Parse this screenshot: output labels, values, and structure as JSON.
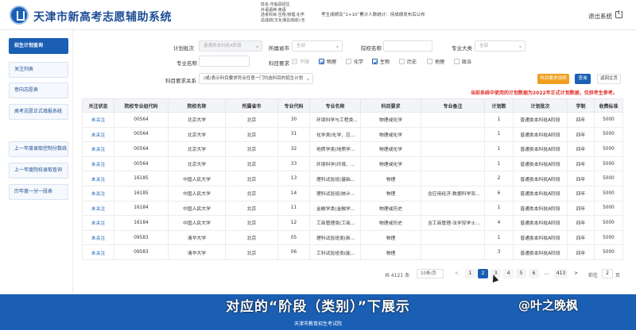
{
  "header": {
    "title": "天津市新高考志愿辅助系统",
    "user_lines": [
      "姓名:市临县招生",
      "外语语种:英语",
      "选考科目:生物,物理,化学",
      "总成绩(文化课总成绩):无"
    ],
    "notice": "考生成绩及“1+10”累计人数统计：待成绩发布后公布",
    "exit_label": "退出系统"
  },
  "sidebar": {
    "items": [
      {
        "label": "招生计划查询",
        "active": true
      },
      {
        "label": "关注列表",
        "active": false
      },
      {
        "label": "意向志愿表",
        "active": false
      },
      {
        "label": "高考志愿正式填报系统",
        "active": false
      },
      {
        "label": "上一年度录取控制分数线",
        "active": false
      },
      {
        "label": "上一年度院校录取查询",
        "active": false
      },
      {
        "label": "历年度一分一段表",
        "active": false
      }
    ]
  },
  "filters": {
    "plan_batch": {
      "label": "计划批次",
      "value": "普通类本科批A阶段"
    },
    "province": {
      "label": "所属省市",
      "placeholder": "全部"
    },
    "school_name": {
      "label": "院校名称",
      "value": ""
    },
    "major_category": {
      "label": "专业大类",
      "placeholder": "全部"
    },
    "major_name": {
      "label": "专业名称",
      "value": ""
    },
    "subject_req": {
      "label": "科目要求",
      "options": [
        {
          "label": "不限",
          "checked": false,
          "disabled": true
        },
        {
          "label": "物理",
          "checked": true,
          "disabled": false
        },
        {
          "label": "化学",
          "checked": false,
          "disabled": false
        },
        {
          "label": "生物",
          "checked": true,
          "disabled": false
        },
        {
          "label": "历史",
          "checked": false,
          "disabled": false
        },
        {
          "label": "地理",
          "checked": false,
          "disabled": false
        },
        {
          "label": "政治",
          "checked": false,
          "disabled": false
        }
      ]
    },
    "subject_relation": {
      "label": "科目要求关系",
      "value": "(或)表示科目要求符合任意一门均选科目的招生计划"
    }
  },
  "buttons": {
    "subject_explain": "科目要求说明",
    "search": "查询",
    "back_home": "返回主页"
  },
  "warning": "当前系统中使用的计划数据为2022年正式计划数据，仅供考生参考。",
  "table": {
    "headers": [
      "关注状态",
      "院校专业组代码",
      "院校名称",
      "所属省市",
      "专业代码",
      "专业名称",
      "科目要求",
      "专业备注",
      "计划数",
      "计划批次",
      "学制",
      "收费标准"
    ],
    "rows": [
      [
        "未关注",
        "00564",
        "北京大学",
        "北京",
        "30",
        "环境科学与工程类...",
        "物理或化学",
        "",
        "1",
        "普通类本科批A阶段",
        "四年",
        "5000"
      ],
      [
        "未关注",
        "00564",
        "北京大学",
        "北京",
        "31",
        "化学类(化学、应...",
        "物理或化学",
        "",
        "1",
        "普通类本科批A阶段",
        "四年",
        "5000"
      ],
      [
        "未关注",
        "00564",
        "北京大学",
        "北京",
        "32",
        "地质学类(地质学...",
        "物理或化学",
        "",
        "1",
        "普通类本科批A阶段",
        "四年",
        "5000"
      ],
      [
        "未关注",
        "00564",
        "北京大学",
        "北京",
        "33",
        "环境科学(环境、...",
        "物理或化学",
        "",
        "1",
        "普通类本科批A阶段",
        "四年",
        "5000"
      ],
      [
        "未关注",
        "16185",
        "中国人民大学",
        "北京",
        "13",
        "理科试验班(基础...",
        "物理",
        "",
        "2",
        "普通类本科批A阶段",
        "四年",
        "5000"
      ],
      [
        "未关注",
        "16185",
        "中国人民大学",
        "北京",
        "14",
        "理科试验班(统计...",
        "物理",
        "含应用经济-数据科学双...",
        "6",
        "普通类本科批A阶段",
        "四年",
        "5000"
      ],
      [
        "未关注",
        "16184",
        "中国人民大学",
        "北京",
        "11",
        "金融学类(金融学...",
        "物理或历史",
        "",
        "1",
        "普通类本科批A阶段",
        "四年",
        "5000"
      ],
      [
        "未关注",
        "16184",
        "中国人民大学",
        "北京",
        "12",
        "工商管理类(工商...",
        "物理或历史",
        "含工商管理-法学双学士...",
        "4",
        "普通类本科批A阶段",
        "四年",
        "5000"
      ],
      [
        "未关注",
        "09583",
        "清华大学",
        "北京",
        "05",
        "理科试验班类(新...",
        "物理",
        "",
        "1",
        "普通类本科批A阶段",
        "四年",
        "5000"
      ],
      [
        "未关注",
        "09583",
        "清华大学",
        "北京",
        "06",
        "工科试验班类(能...",
        "物理",
        "",
        "3",
        "普通类本科批A阶段",
        "四年",
        "5000"
      ]
    ]
  },
  "pagination": {
    "total": "共 4121 条",
    "page_size": "10条/页",
    "prev": "<",
    "pages": [
      "1",
      "2",
      "3",
      "4",
      "5",
      "6",
      "...",
      "413"
    ],
    "current": "2",
    "next": ">",
    "goto_label": "前往",
    "goto_value": "2",
    "goto_suffix": "页"
  },
  "caption": "对应的“阶段（类别）”下展示",
  "watermark": "@叶之晚枫",
  "footer": "天津市教育招生考试院",
  "colors": {
    "primary": "#1a5fb4",
    "warning": "#e0302a",
    "accent": "#f0a020"
  }
}
